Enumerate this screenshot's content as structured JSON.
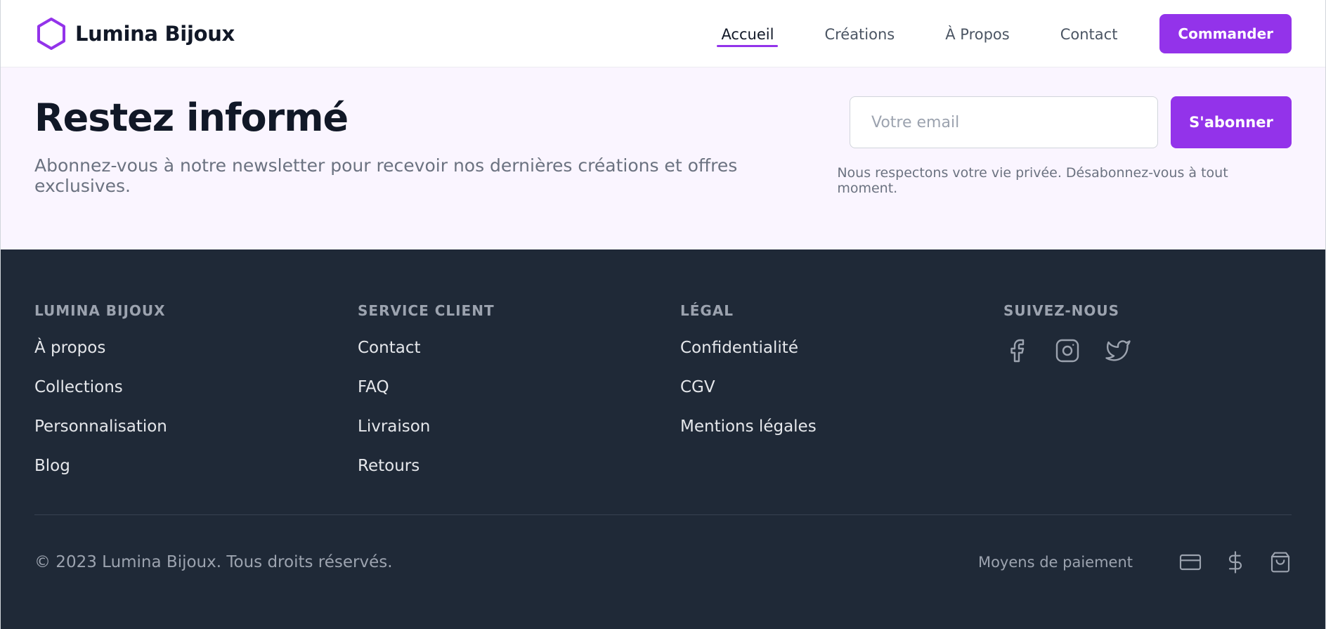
{
  "header": {
    "brand_name": "Lumina Bijoux",
    "logo_icon": "hexagon-icon",
    "nav": [
      {
        "label": "Accueil",
        "active": true
      },
      {
        "label": "Créations",
        "active": false
      },
      {
        "label": "À Propos",
        "active": false
      },
      {
        "label": "Contact",
        "active": false
      }
    ],
    "cta_label": "Commander"
  },
  "newsletter": {
    "title": "Restez informé",
    "subtitle": "Abonnez-vous à notre newsletter pour recevoir nos dernières créations et offres exclusives.",
    "email_placeholder": "Votre email",
    "email_value": "",
    "subscribe_label": "S'abonner",
    "privacy_note": "Nous respectons votre vie privée. Désabonnez-vous à tout moment."
  },
  "footer": {
    "columns": [
      {
        "title": "Lumina Bijoux",
        "links": [
          "À propos",
          "Collections",
          "Personnalisation",
          "Blog"
        ]
      },
      {
        "title": "Service Client",
        "links": [
          "Contact",
          "FAQ",
          "Livraison",
          "Retours"
        ]
      },
      {
        "title": "Légal",
        "links": [
          "Confidentialité",
          "CGV",
          "Mentions légales"
        ]
      },
      {
        "title": "Suivez-nous",
        "socials": [
          "facebook-icon",
          "instagram-icon",
          "twitter-icon"
        ]
      }
    ],
    "copyright": "© 2023 Lumina Bijoux. Tous droits réservés.",
    "payments_label": "Moyens de paiement",
    "payment_icons": [
      "credit-card-icon",
      "dollar-icon",
      "shopping-bag-icon"
    ]
  },
  "colors": {
    "accent": "#9333ea",
    "newsletter_bg": "#faf5ff",
    "footer_bg": "#1f2937",
    "heading": "#111827",
    "muted": "#6b7280"
  }
}
